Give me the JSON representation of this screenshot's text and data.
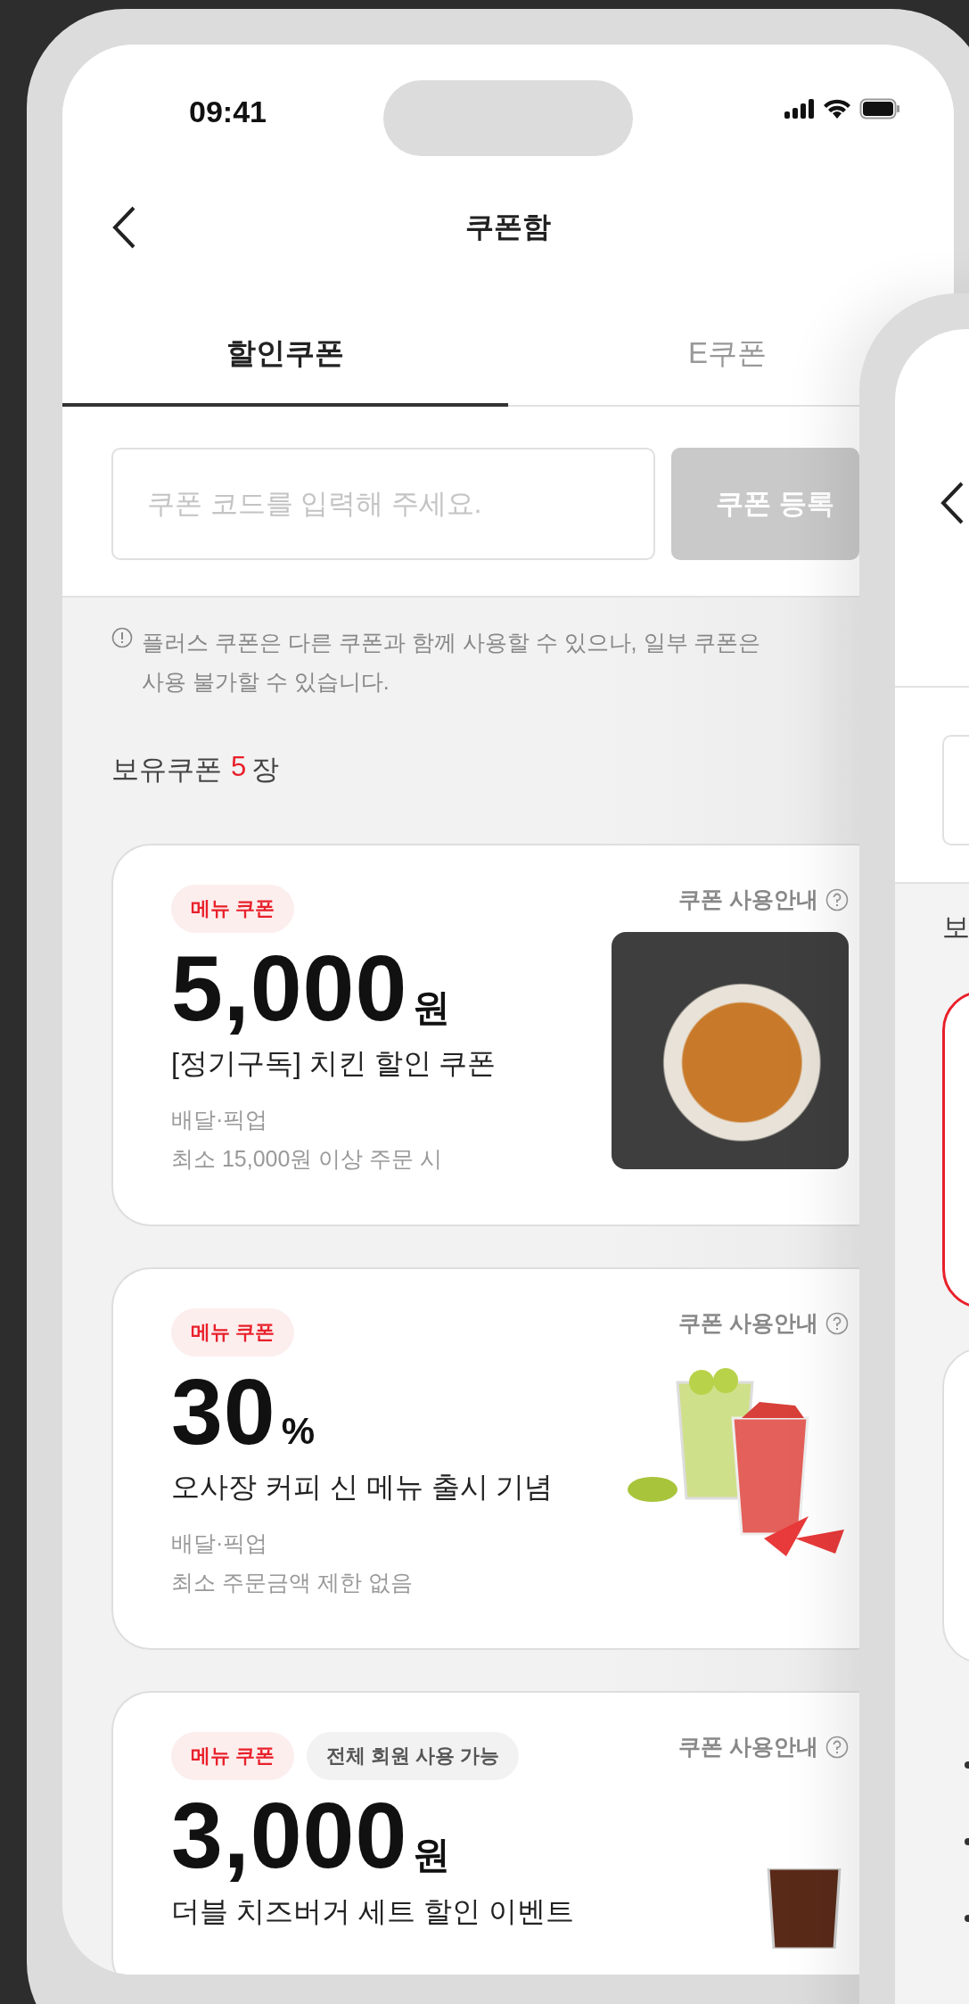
{
  "status_bar": {
    "time": "09:41"
  },
  "header": {
    "title": "쿠폰함"
  },
  "tabs": [
    {
      "label": "할인쿠폰",
      "selected": true
    },
    {
      "label": "E쿠폰",
      "selected": false
    }
  ],
  "coupon_code": {
    "placeholder": "쿠폰 코드를 입력해 주세요.",
    "button": "쿠폰 등록",
    "disabled": true
  },
  "notice": {
    "lines": [
      "플러스 쿠폰은 다른 쿠폰과 함께 사용할 수 있으나, 일부 쿠폰은",
      "사용 불가할 수 있습니다."
    ]
  },
  "owned": {
    "label": "보유쿠폰",
    "count": "5",
    "unit": "장"
  },
  "coupons": [
    {
      "tags": [
        {
          "label": "메뉴 쿠폰",
          "kind": "menu"
        }
      ],
      "guide": "쿠폰 사용안내",
      "amount": "5,000",
      "unit": "원",
      "title": "[정기구독] 치킨 할인 쿠폰",
      "meta": [
        "배달·픽업",
        "최소 15,000원 이상 주문 시"
      ],
      "kind": "photo"
    },
    {
      "tags": [
        {
          "label": "메뉴 쿠폰",
          "kind": "menu"
        }
      ],
      "guide": "쿠폰 사용안내",
      "amount": "30",
      "unit": "%",
      "title": "오사장 커피 신 메뉴 출시 기념",
      "meta": [
        "배달·픽업",
        "최소 주문금액 제한 없음"
      ],
      "kind": "drinks"
    },
    {
      "tags": [
        {
          "label": "메뉴 쿠폰",
          "kind": "menu"
        },
        {
          "label": "전체 회원 사용 가능",
          "kind": "audience"
        }
      ],
      "guide": "쿠폰 사용안내",
      "amount": "3,000",
      "unit": "원",
      "title": "더블 치즈버거 세트 할인 이벤트",
      "kind": "drink"
    }
  ],
  "second_screen": {
    "section_label": "보",
    "cards": [
      {
        "highlighted": true
      },
      {
        "highlighted": false
      }
    ]
  }
}
